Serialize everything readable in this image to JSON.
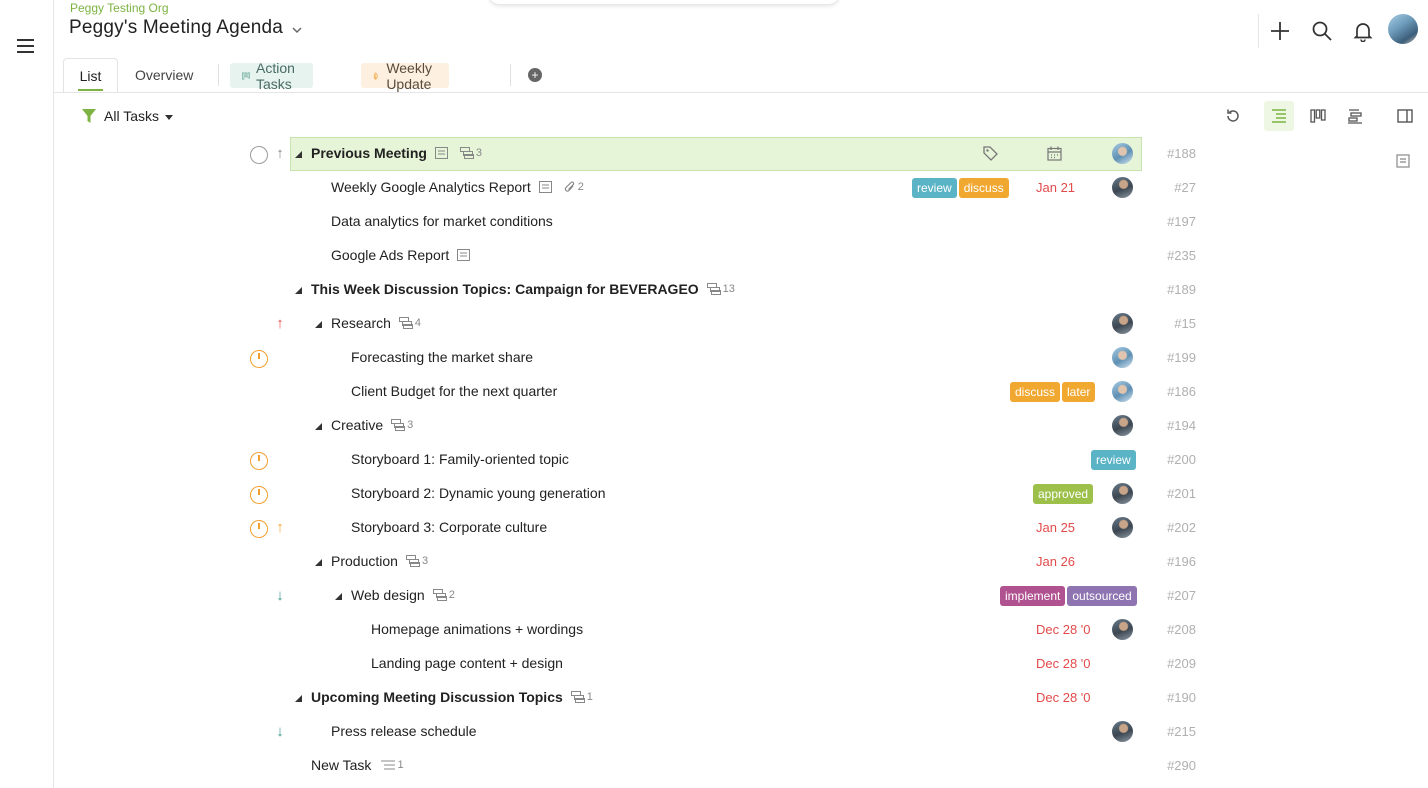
{
  "header": {
    "org": "Peggy Testing Org",
    "title": "Peggy's Meeting Agenda"
  },
  "tabs": {
    "list": "List",
    "overview": "Overview",
    "action_tasks": "Action Tasks",
    "weekly_update": "Weekly Update",
    "add": "+"
  },
  "toolbar": {
    "filter_label": "All Tasks"
  },
  "tag_colors": {
    "review": "#5bb3c6",
    "discuss": "#f0a830",
    "later": "#f0a830",
    "approved": "#9cc04a",
    "implement": "#b0528f",
    "outsourced": "#8e74b0"
  },
  "rows": [
    {
      "name": "Previous Meeting",
      "subtasks": "3",
      "id": "#188"
    },
    {
      "name": "Weekly Google Analytics Report",
      "attachments": "2",
      "tags": [
        "review",
        "discuss"
      ],
      "due": "Jan 21",
      "id": "#27"
    },
    {
      "name": "Data analytics for market conditions",
      "id": "#197"
    },
    {
      "name": "Google Ads Report",
      "id": "#235"
    },
    {
      "name": "This Week Discussion Topics: Campaign for BEVERAGEO",
      "subtasks": "13",
      "id": "#189"
    },
    {
      "name": "Research",
      "subtasks": "4",
      "id": "#15"
    },
    {
      "name": "Forecasting the market share",
      "id": "#199"
    },
    {
      "name": "Client Budget for the next quarter",
      "tags": [
        "discuss",
        "later"
      ],
      "id": "#186"
    },
    {
      "name": "Creative",
      "subtasks": "3",
      "id": "#194"
    },
    {
      "name": "Storyboard 1: Family-oriented topic",
      "tags": [
        "review"
      ],
      "id": "#200"
    },
    {
      "name": "Storyboard 2: Dynamic young generation",
      "tags": [
        "approved"
      ],
      "id": "#201"
    },
    {
      "name": "Storyboard 3: Corporate culture",
      "due": "Jan 25",
      "id": "#202"
    },
    {
      "name": "Production",
      "subtasks": "3",
      "due": "Jan 26",
      "id": "#196"
    },
    {
      "name": "Web design",
      "subtasks": "2",
      "tags": [
        "implement",
        "outsourced"
      ],
      "id": "#207"
    },
    {
      "name": "Homepage animations + wordings",
      "due": "Dec 28 '0",
      "id": "#208"
    },
    {
      "name": "Landing page content + design",
      "due": "Dec 28 '0",
      "id": "#209"
    },
    {
      "name": "Upcoming Meeting Discussion Topics",
      "subtasks": "1",
      "due": "Dec 28 '0",
      "id": "#190"
    },
    {
      "name": "Press release schedule",
      "id": "#215"
    },
    {
      "name": "New Task",
      "comments": "1",
      "id": "#290"
    }
  ]
}
